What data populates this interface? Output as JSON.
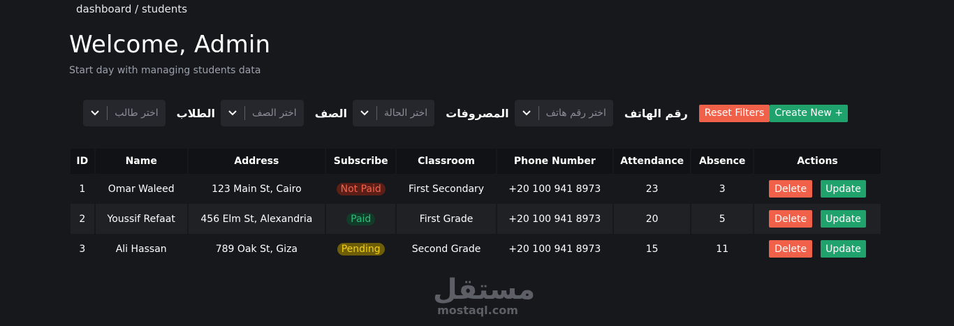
{
  "breadcrumb": "dashboard / students",
  "header": {
    "title": "Welcome, Admin",
    "subtitle": "Start day with managing students data"
  },
  "filters": {
    "create_label": "Create New +",
    "reset_label": "Reset Filters",
    "phone": {
      "label": "رقم الهاتف",
      "placeholder": "اختر رقم هاتف"
    },
    "fees": {
      "label": "المصروفات",
      "placeholder": "اختر الحالة"
    },
    "grade": {
      "label": "الصف",
      "placeholder": "اختر الصف"
    },
    "student": {
      "label": "الطلاب",
      "placeholder": "اختر طالب"
    }
  },
  "table": {
    "columns": [
      "ID",
      "Name",
      "Address",
      "Subscribe",
      "Classroom",
      "Phone Number",
      "Attendance",
      "Absence",
      "Actions"
    ],
    "rows": [
      {
        "id": "1",
        "name": "Omar Waleed",
        "address": "123 Main St, Cairo",
        "subscribe": "Not Paid",
        "classroom": "First Secondary",
        "phone": "+20 100 941 8973",
        "attendance": "23",
        "absence": "3"
      },
      {
        "id": "2",
        "name": "Youssif Refaat",
        "address": "456 Elm St, Alexandria",
        "subscribe": "Paid",
        "classroom": "First Grade",
        "phone": "+20 100 941 8973",
        "attendance": "20",
        "absence": "5"
      },
      {
        "id": "3",
        "name": "Ali Hassan",
        "address": "789 Oak St, Giza",
        "subscribe": "Pending",
        "classroom": "Second Grade",
        "phone": "+20 100 941 8973",
        "attendance": "15",
        "absence": "11"
      }
    ],
    "delete_label": "Delete",
    "update_label": "Update"
  },
  "watermark": {
    "arabic": "مستقل",
    "latin": "mostaql.com"
  },
  "colors": {
    "background": "#17181c",
    "create": "#20a26c",
    "danger": "#f16149",
    "paid": "#2ebd7a",
    "pending": "#f2cf1a"
  }
}
